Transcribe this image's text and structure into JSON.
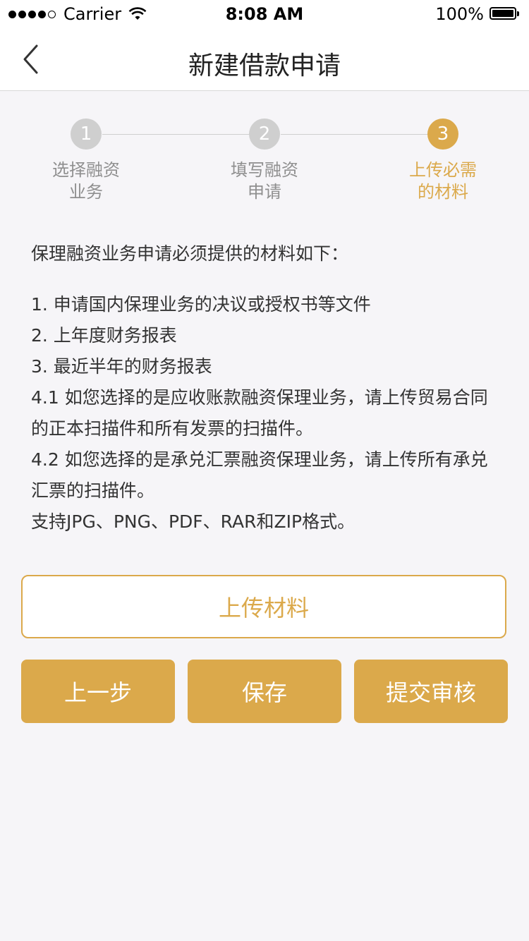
{
  "status_bar": {
    "carrier": "Carrier",
    "time": "8:08 AM",
    "battery": "100%"
  },
  "nav": {
    "title": "新建借款申请",
    "back_icon": "chevron-left-icon"
  },
  "steps": [
    {
      "number": "1",
      "label": "选择融资\n业务",
      "state": "inactive"
    },
    {
      "number": "2",
      "label": "填写融资\n申请",
      "state": "inactive"
    },
    {
      "number": "3",
      "label": "上传必需\n的材料",
      "state": "active"
    }
  ],
  "materials": {
    "intro": "保理融资业务申请必须提供的材料如下：",
    "items": [
      "1. 申请国内保理业务的决议或授权书等文件",
      "2. 上年度财务报表",
      "3. 最近半年的财务报表",
      "4.1 如您选择的是应收账款融资保理业务，请上传贸易合同的正本扫描件和所有发票的扫描件。",
      "4.2 如您选择的是承兑汇票融资保理业务，请上传所有承兑汇票的扫描件。"
    ],
    "note": "支持JPG、PNG、PDF、RAR和ZIP格式。"
  },
  "upload_button": "上传材料",
  "actions": {
    "prev": "上一步",
    "save": "保存",
    "submit": "提交审核"
  },
  "colors": {
    "accent": "#dba94b",
    "inactive_step": "#cfcfcf",
    "background": "#f6f5f8"
  }
}
